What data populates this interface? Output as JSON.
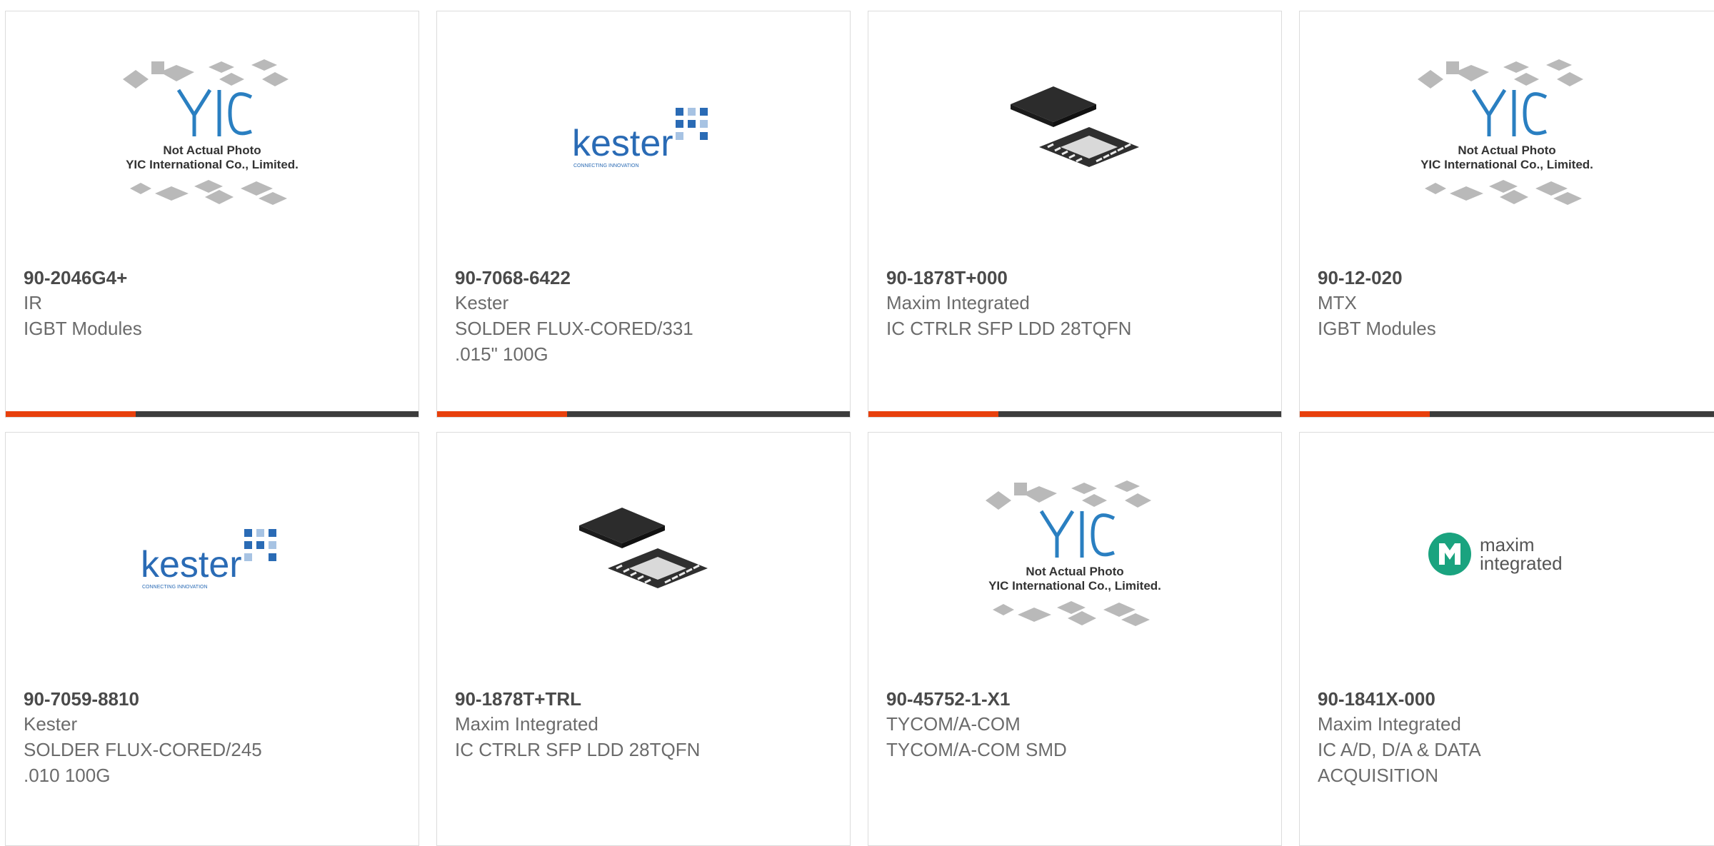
{
  "products": [
    {
      "part": "90-2046G4+",
      "manufacturer": "IR",
      "description": "IGBT Modules",
      "image": "yic-placeholder-icon",
      "bar": true
    },
    {
      "part": "90-7068-6422",
      "manufacturer": "Kester",
      "description": "SOLDER FLUX-CORED/331\n.015\" 100G",
      "image": "kester-logo-icon",
      "bar": true
    },
    {
      "part": "90-1878T+000",
      "manufacturer": "Maxim Integrated",
      "description": "IC CTRLR SFP LDD 28TQFN",
      "image": "qfn-chip-icon",
      "bar": true
    },
    {
      "part": "90-12-020",
      "manufacturer": "MTX",
      "description": "IGBT Modules",
      "image": "yic-placeholder-icon",
      "bar": true
    },
    {
      "part": "90-7059-8810",
      "manufacturer": "Kester",
      "description": "SOLDER FLUX-CORED/245\n.010 100G",
      "image": "kester-logo-icon",
      "bar": false
    },
    {
      "part": "90-1878T+TRL",
      "manufacturer": "Maxim Integrated",
      "description": "IC CTRLR SFP LDD 28TQFN",
      "image": "qfn-chip-icon",
      "bar": false
    },
    {
      "part": "90-45752-1-X1",
      "manufacturer": "TYCOM/A-COM",
      "description": "TYCOM/A-COM SMD",
      "image": "yic-placeholder-icon",
      "bar": false
    },
    {
      "part": "90-1841X-000",
      "manufacturer": "Maxim Integrated",
      "description": "IC A/D, D/A & DATA\nACQUISITION",
      "image": "maxim-logo-icon",
      "bar": false
    }
  ],
  "placeholder": {
    "logo_text": "YIC",
    "line1": "Not Actual Photo",
    "line2": "YIC International Co., Limited."
  },
  "kester": {
    "name": "kester",
    "tagline": "CONNECTING INNOVATION"
  },
  "maxim": {
    "line1": "maxim",
    "line2": "integrated"
  },
  "colors": {
    "accent": "#e8400c",
    "bar": "#3c3c3c",
    "border": "#dcdcdc",
    "part_text": "#4a4a4a",
    "meta_text": "#6b6b6b"
  }
}
